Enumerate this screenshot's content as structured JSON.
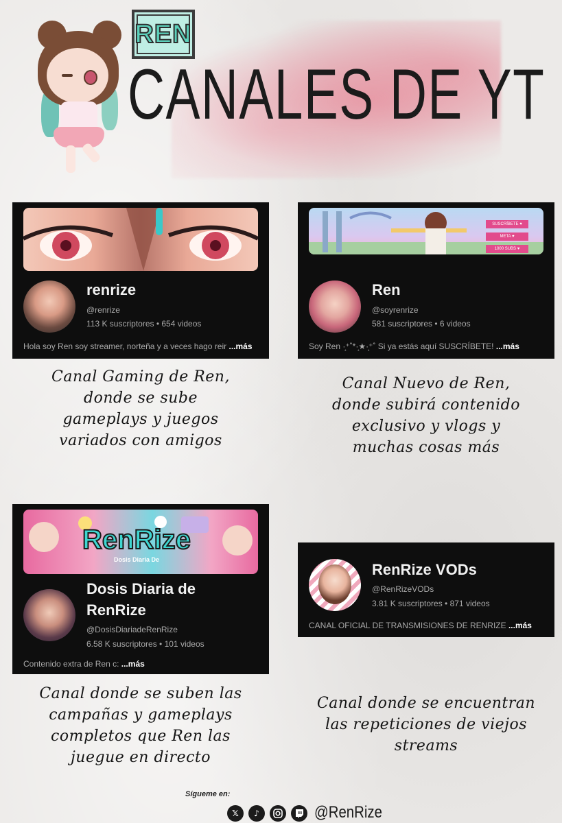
{
  "header": {
    "logo_text": "REN",
    "title": "CANALES DE YT"
  },
  "channels": [
    {
      "name": "renrize",
      "handle": "@renrize",
      "stats": "113 K suscriptores • 654 videos",
      "description": "Hola soy Ren soy streamer, norteña y a veces hago reir",
      "more": "...más",
      "caption": "Canal Gaming de Ren,\ndonde se sube\ngameplays y juegos\nvariados con amigos"
    },
    {
      "name": "Ren",
      "handle": "@soyrenrize",
      "stats": "581 suscriptores • 6 videos",
      "description": "Soy Ren ·͙⁺˚*·͙★·͙⁺˚ Si ya estás aquí SUSCRÍBETE!",
      "more": "...más",
      "banner_signs": [
        "SUSCRÍBETE ♥",
        "META ♥",
        "1000 SUBS ♥"
      ],
      "caption": "Canal Nuevo de Ren,\ndonde subirá contenido\nexclusivo y vlogs y\nmuchas cosas más"
    },
    {
      "name": "Dosis Diaria de\nRenRize",
      "handle": "@DosisDiariadeRenRize",
      "stats": "6.58 K suscriptores • 101 videos",
      "description": "Contenido extra de Ren c:",
      "more": "...más",
      "banner_title": "RenRize",
      "banner_subtitle": "Dosis Diaria De",
      "caption": "Canal donde se suben las\ncampañas y gameplays\ncompletos que Ren las\njuegue en directo"
    },
    {
      "name": "RenRize VODs",
      "handle": "@RenRizeVODs",
      "stats": "3.81 K suscriptores • 871 videos",
      "description": "CANAL OFICIAL DE TRANSMISIONES DE RENRIZE",
      "more": "...más",
      "caption": "Canal donde se encuentran\nlas repeticiones de viejos\nstreams"
    }
  ],
  "footer": {
    "label": "Sígueme en:",
    "icons": [
      "x-icon",
      "tiktok-icon",
      "instagram-icon",
      "twitch-icon"
    ],
    "handle": "@RenRize"
  },
  "colors": {
    "card_bg": "#0e0e0e",
    "accent_pink": "#e8788c",
    "logo_teal": "#5bd1bb"
  }
}
